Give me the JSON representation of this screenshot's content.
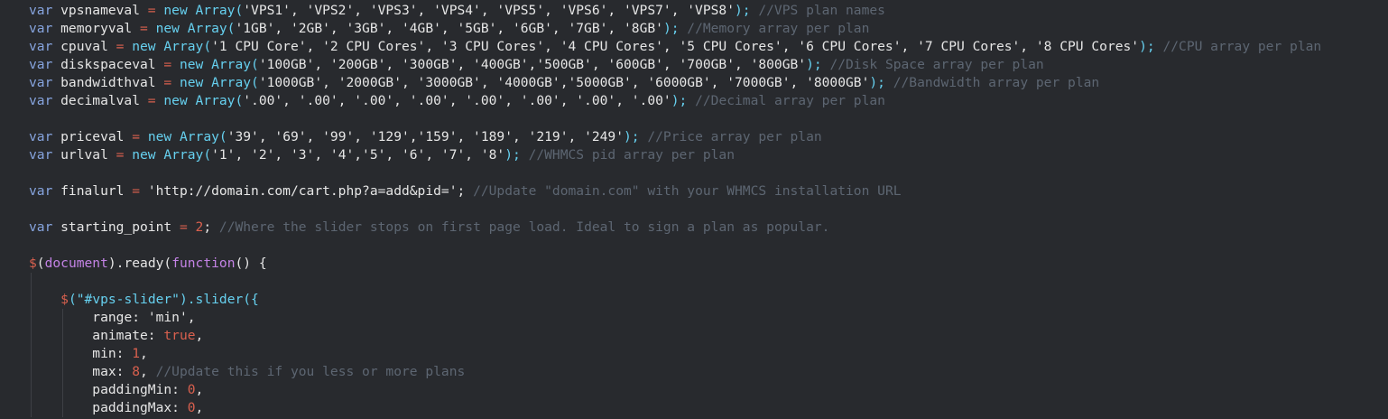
{
  "editor": {
    "colors": {
      "background": "#282a2e",
      "indent_guide": "#3e4045",
      "text": "#e6e6e6",
      "keyword": "#86a4de",
      "operator": "#d9604e",
      "number": "#d9604e",
      "string": "#e6e6e6",
      "comment": "#5d6672",
      "builtin": "#66d0ef",
      "function": "#c483e6",
      "jquery": "#d9604e"
    },
    "lines": [
      {
        "indent": 0,
        "guides": 0,
        "tokens": [
          {
            "t": "var",
            "c": "keyword"
          },
          {
            "t": " vpsnameval ",
            "c": "text"
          },
          {
            "t": "=",
            "c": "operator"
          },
          {
            "t": " new Array(",
            "c": "builtin"
          },
          {
            "t": "'VPS1', 'VPS2', 'VPS3', 'VPS4', 'VPS5', 'VPS6', 'VPS7', 'VPS8'",
            "c": "string"
          },
          {
            "t": ");",
            "c": "builtin"
          },
          {
            "t": " //VPS plan names",
            "c": "comment"
          }
        ]
      },
      {
        "indent": 0,
        "guides": 0,
        "tokens": [
          {
            "t": "var",
            "c": "keyword"
          },
          {
            "t": " memoryval ",
            "c": "text"
          },
          {
            "t": "=",
            "c": "operator"
          },
          {
            "t": " new Array(",
            "c": "builtin"
          },
          {
            "t": "'1GB', '2GB', '3GB', '4GB', '5GB', '6GB', '7GB', '8GB'",
            "c": "string"
          },
          {
            "t": ");",
            "c": "builtin"
          },
          {
            "t": " //Memory array per plan",
            "c": "comment"
          }
        ]
      },
      {
        "indent": 0,
        "guides": 0,
        "tokens": [
          {
            "t": "var",
            "c": "keyword"
          },
          {
            "t": " cpuval ",
            "c": "text"
          },
          {
            "t": "=",
            "c": "operator"
          },
          {
            "t": " new Array(",
            "c": "builtin"
          },
          {
            "t": "'1 CPU Core', '2 CPU Cores', '3 CPU Cores', '4 CPU Cores', '5 CPU Cores', '6 CPU Cores', '7 CPU Cores', '8 CPU Cores'",
            "c": "string"
          },
          {
            "t": ");",
            "c": "builtin"
          },
          {
            "t": " //CPU array per plan",
            "c": "comment"
          }
        ]
      },
      {
        "indent": 0,
        "guides": 0,
        "tokens": [
          {
            "t": "var",
            "c": "keyword"
          },
          {
            "t": " diskspaceval ",
            "c": "text"
          },
          {
            "t": "=",
            "c": "operator"
          },
          {
            "t": " new Array(",
            "c": "builtin"
          },
          {
            "t": "'100GB', '200GB', '300GB', '400GB','500GB', '600GB', '700GB', '800GB'",
            "c": "string"
          },
          {
            "t": ");",
            "c": "builtin"
          },
          {
            "t": " //Disk Space array per plan",
            "c": "comment"
          }
        ]
      },
      {
        "indent": 0,
        "guides": 0,
        "tokens": [
          {
            "t": "var",
            "c": "keyword"
          },
          {
            "t": " bandwidthval ",
            "c": "text"
          },
          {
            "t": "=",
            "c": "operator"
          },
          {
            "t": " new Array(",
            "c": "builtin"
          },
          {
            "t": "'1000GB', '2000GB', '3000GB', '4000GB','5000GB', '6000GB', '7000GB', '8000GB'",
            "c": "string"
          },
          {
            "t": ");",
            "c": "builtin"
          },
          {
            "t": " //Bandwidth array per plan",
            "c": "comment"
          }
        ]
      },
      {
        "indent": 0,
        "guides": 0,
        "tokens": [
          {
            "t": "var",
            "c": "keyword"
          },
          {
            "t": " decimalval ",
            "c": "text"
          },
          {
            "t": "=",
            "c": "operator"
          },
          {
            "t": " new Array(",
            "c": "builtin"
          },
          {
            "t": "'.00', '.00', '.00', '.00', '.00', '.00', '.00', '.00'",
            "c": "string"
          },
          {
            "t": ");",
            "c": "builtin"
          },
          {
            "t": " //Decimal array per plan",
            "c": "comment"
          }
        ]
      },
      {
        "indent": 0,
        "guides": 0,
        "tokens": []
      },
      {
        "indent": 0,
        "guides": 0,
        "tokens": [
          {
            "t": "var",
            "c": "keyword"
          },
          {
            "t": " priceval ",
            "c": "text"
          },
          {
            "t": "=",
            "c": "operator"
          },
          {
            "t": " new Array(",
            "c": "builtin"
          },
          {
            "t": "'39', '69', '99', '129','159', '189', '219', '249'",
            "c": "string"
          },
          {
            "t": ");",
            "c": "builtin"
          },
          {
            "t": " //Price array per plan",
            "c": "comment"
          }
        ]
      },
      {
        "indent": 0,
        "guides": 0,
        "tokens": [
          {
            "t": "var",
            "c": "keyword"
          },
          {
            "t": " urlval ",
            "c": "text"
          },
          {
            "t": "=",
            "c": "operator"
          },
          {
            "t": " new Array(",
            "c": "builtin"
          },
          {
            "t": "'1', '2', '3', '4','5', '6', '7', '8'",
            "c": "string"
          },
          {
            "t": ");",
            "c": "builtin"
          },
          {
            "t": " //WHMCS pid array per plan",
            "c": "comment"
          }
        ]
      },
      {
        "indent": 0,
        "guides": 0,
        "tokens": []
      },
      {
        "indent": 0,
        "guides": 0,
        "tokens": [
          {
            "t": "var",
            "c": "keyword"
          },
          {
            "t": " finalurl ",
            "c": "text"
          },
          {
            "t": "=",
            "c": "operator"
          },
          {
            "t": " 'http://domain.com/cart.php?a=add&pid='",
            "c": "string"
          },
          {
            "t": ";",
            "c": "text"
          },
          {
            "t": " //Update \"domain.com\" with your WHMCS installation URL",
            "c": "comment"
          }
        ]
      },
      {
        "indent": 0,
        "guides": 0,
        "tokens": []
      },
      {
        "indent": 0,
        "guides": 0,
        "tokens": [
          {
            "t": "var",
            "c": "keyword"
          },
          {
            "t": " starting_point ",
            "c": "text"
          },
          {
            "t": "=",
            "c": "operator"
          },
          {
            "t": " 2",
            "c": "number"
          },
          {
            "t": ";",
            "c": "text"
          },
          {
            "t": " //Where the slider stops on first page load. Ideal to sign a plan as popular.",
            "c": "comment"
          }
        ]
      },
      {
        "indent": 0,
        "guides": 0,
        "tokens": []
      },
      {
        "indent": 0,
        "guides": 0,
        "tokens": [
          {
            "t": "$",
            "c": "jquery"
          },
          {
            "t": "(",
            "c": "text"
          },
          {
            "t": "document",
            "c": "function"
          },
          {
            "t": ").ready(",
            "c": "text"
          },
          {
            "t": "function",
            "c": "function"
          },
          {
            "t": "() {",
            "c": "text"
          }
        ]
      },
      {
        "indent": 0,
        "guides": 1,
        "tokens": []
      },
      {
        "indent": 4,
        "guides": 1,
        "tokens": [
          {
            "t": "$",
            "c": "jquery"
          },
          {
            "t": "(",
            "c": "builtin"
          },
          {
            "t": "\"#vps-slider\"",
            "c": "builtin"
          },
          {
            "t": ").slider({",
            "c": "builtin"
          }
        ]
      },
      {
        "indent": 8,
        "guides": 2,
        "tokens": [
          {
            "t": "range: ",
            "c": "text"
          },
          {
            "t": "'min'",
            "c": "string"
          },
          {
            "t": ",",
            "c": "text"
          }
        ]
      },
      {
        "indent": 8,
        "guides": 2,
        "tokens": [
          {
            "t": "animate: ",
            "c": "text"
          },
          {
            "t": "true",
            "c": "number"
          },
          {
            "t": ",",
            "c": "text"
          }
        ]
      },
      {
        "indent": 8,
        "guides": 2,
        "tokens": [
          {
            "t": "min: ",
            "c": "text"
          },
          {
            "t": "1",
            "c": "number"
          },
          {
            "t": ",",
            "c": "text"
          }
        ]
      },
      {
        "indent": 8,
        "guides": 2,
        "tokens": [
          {
            "t": "max: ",
            "c": "text"
          },
          {
            "t": "8",
            "c": "number"
          },
          {
            "t": ",",
            "c": "text"
          },
          {
            "t": " //Update this if you less or more plans",
            "c": "comment"
          }
        ]
      },
      {
        "indent": 8,
        "guides": 2,
        "tokens": [
          {
            "t": "paddingMin: ",
            "c": "text"
          },
          {
            "t": "0",
            "c": "number"
          },
          {
            "t": ",",
            "c": "text"
          }
        ]
      },
      {
        "indent": 8,
        "guides": 2,
        "tokens": [
          {
            "t": "paddingMax: ",
            "c": "text"
          },
          {
            "t": "0",
            "c": "number"
          },
          {
            "t": ",",
            "c": "text"
          }
        ]
      }
    ]
  }
}
